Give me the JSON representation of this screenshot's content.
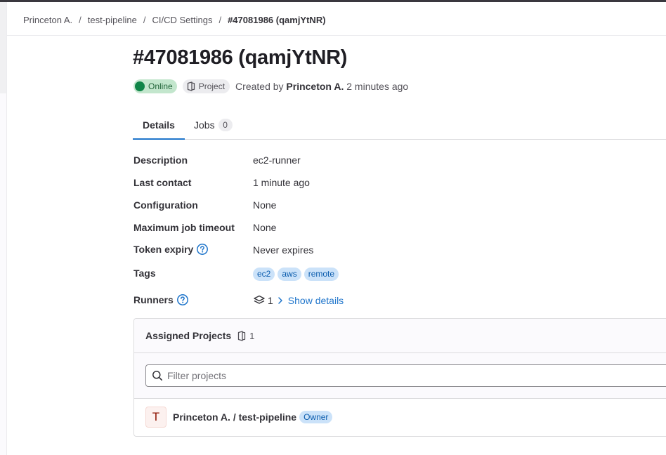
{
  "breadcrumb": {
    "items": [
      "Princeton A.",
      "test-pipeline",
      "CI/CD Settings"
    ],
    "separator": "/",
    "current": "#47081986 (qamjYtNR)"
  },
  "runner": {
    "title": "#47081986 (qamjYtNR)",
    "status": "Online",
    "type": "Project",
    "created_prefix": "Created by",
    "created_by": "Princeton A.",
    "created_when": "2 minutes ago"
  },
  "tabs": [
    {
      "label": "Details",
      "active": true
    },
    {
      "label": "Jobs",
      "count": "0",
      "active": false
    }
  ],
  "details": {
    "description": {
      "label": "Description",
      "value": "ec2-runner"
    },
    "last_contact": {
      "label": "Last contact",
      "value": "1 minute ago"
    },
    "configuration": {
      "label": "Configuration",
      "value": "None"
    },
    "max_timeout": {
      "label": "Maximum job timeout",
      "value": "None"
    },
    "token_expiry": {
      "label": "Token expiry",
      "value": "Never expires"
    },
    "tags": {
      "label": "Tags",
      "values": [
        "ec2",
        "aws",
        "remote"
      ]
    },
    "runners": {
      "label": "Runners",
      "count": "1",
      "link": "Show details"
    }
  },
  "assigned_projects": {
    "title": "Assigned Projects",
    "count": "1",
    "filter_placeholder": "Filter projects",
    "projects": [
      {
        "avatar_letter": "T",
        "name": "Princeton A. / test-pipeline",
        "role": "Owner"
      }
    ]
  },
  "colors": {
    "accent": "#1f75cb",
    "online_dot": "#108548",
    "online_bg": "#c3e6cd",
    "tag_bg": "#cbe2f9",
    "tag_text": "#0b5cad"
  }
}
